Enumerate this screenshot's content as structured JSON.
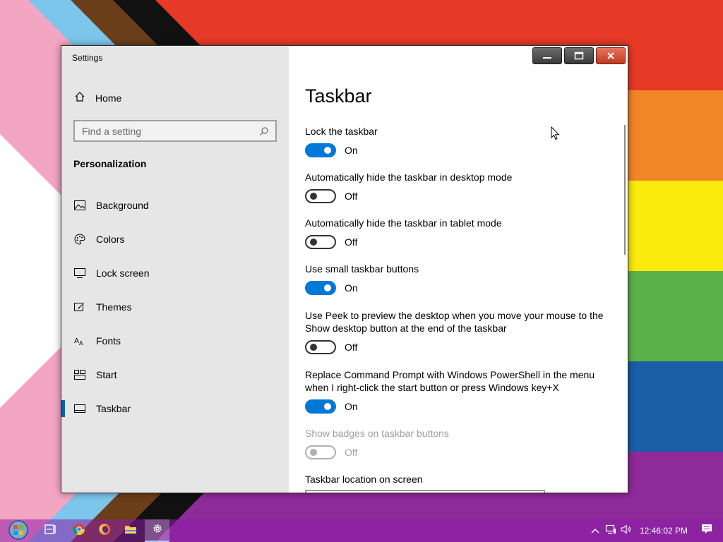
{
  "window": {
    "title": "Settings",
    "caption": {
      "minimize": "–",
      "maximize": "□",
      "close": "✕"
    }
  },
  "sidebar": {
    "home_label": "Home",
    "search_placeholder": "Find a setting",
    "section_heading": "Personalization",
    "items": [
      {
        "label": "Background",
        "icon": "image-icon"
      },
      {
        "label": "Colors",
        "icon": "palette-icon"
      },
      {
        "label": "Lock screen",
        "icon": "monitor-icon"
      },
      {
        "label": "Themes",
        "icon": "brush-icon"
      },
      {
        "label": "Fonts",
        "icon": "font-icon"
      },
      {
        "label": "Start",
        "icon": "start-grid-icon"
      },
      {
        "label": "Taskbar",
        "icon": "taskbar-icon",
        "active": true
      }
    ]
  },
  "main": {
    "title": "Taskbar",
    "settings": [
      {
        "label": "Lock the taskbar",
        "state": "On"
      },
      {
        "label": "Automatically hide the taskbar in desktop mode",
        "state": "Off"
      },
      {
        "label": "Automatically hide the taskbar in tablet mode",
        "state": "Off"
      },
      {
        "label": "Use small taskbar buttons",
        "state": "On"
      },
      {
        "label": "Use Peek to preview the desktop when you move your mouse to the Show desktop button at the end of the taskbar",
        "state": "Off"
      },
      {
        "label": "Replace Command Prompt with Windows PowerShell in the menu when I right-click the start button or press Windows key+X",
        "state": "On"
      },
      {
        "label": "Show badges on taskbar buttons",
        "state": "Off",
        "disabled": true
      },
      {
        "label": "Taskbar location on screen"
      }
    ]
  },
  "taskbar": {
    "clock": "12:46:02 PM",
    "apps": [
      "start-orb-icon",
      "task-view-icon",
      "chrome-icon",
      "firefox-icon",
      "file-explorer-icon",
      "settings-gear-icon"
    ]
  },
  "colors": {
    "accent": "#0078d7",
    "sidebar_bg": "#e6e6e6",
    "active_indicator": "#0063b1"
  }
}
